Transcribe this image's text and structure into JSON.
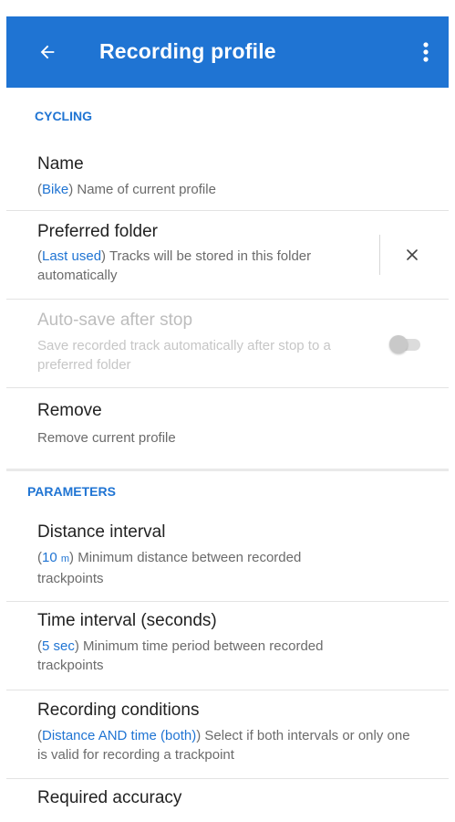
{
  "app_bar": {
    "title": "Recording profile",
    "back_icon": "arrow-left-icon",
    "more_icon": "more-vert-icon",
    "color": "#1f74d3"
  },
  "sections": {
    "cycling": "CYCLING",
    "parameters": "PARAMETERS"
  },
  "items": {
    "name": {
      "title": "Name",
      "value": "Bike",
      "desc": "Name of current profile"
    },
    "preferred_folder": {
      "title": "Preferred folder",
      "value": "Last used",
      "desc": "Tracks will be stored in this folder automatically",
      "clear_icon": "close-icon"
    },
    "auto_save": {
      "title": "Auto-save after stop",
      "desc": "Save recorded track automatically after stop to a preferred folder",
      "enabled": false,
      "checked": false
    },
    "remove": {
      "title": "Remove",
      "desc": "Remove current profile"
    },
    "distance_interval": {
      "title": "Distance interval",
      "value_num": "10",
      "value_unit": "m",
      "desc": "Minimum distance between recorded trackpoints"
    },
    "time_interval": {
      "title": "Time interval (seconds)",
      "value": "5 sec",
      "desc": "Minimum time period between recorded trackpoints"
    },
    "recording_conditions": {
      "title": "Recording conditions",
      "value": "Distance AND time (both)",
      "desc": "Select if both intervals or only one is valid for recording a trackpoint"
    },
    "required_accuracy": {
      "title": "Required accuracy"
    }
  }
}
